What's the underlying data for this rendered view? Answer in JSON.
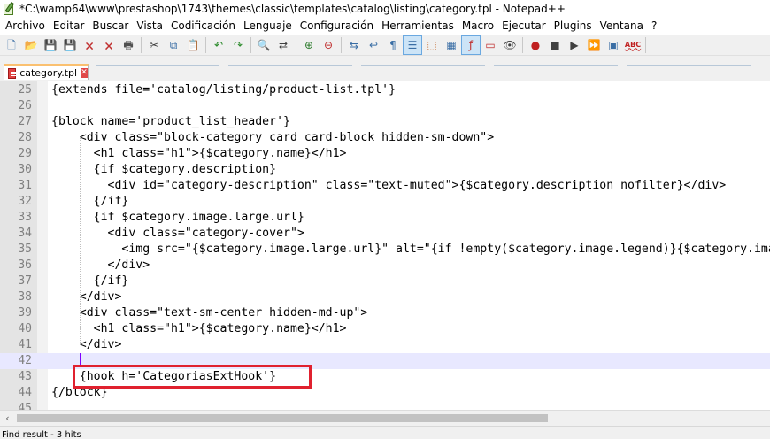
{
  "window": {
    "title": "*C:\\wamp64\\www\\prestashop\\1743\\themes\\classic\\templates\\catalog\\listing\\category.tpl - Notepad++"
  },
  "menu": {
    "items": [
      "Archivo",
      "Editar",
      "Buscar",
      "Vista",
      "Codificación",
      "Lenguaje",
      "Configuración",
      "Herramientas",
      "Macro",
      "Ejecutar",
      "Plugins",
      "Ventana",
      "?"
    ]
  },
  "toolbar": {
    "icons": [
      {
        "name": "new-file-icon",
        "glyph": "🗋",
        "color": "#3a6ea5"
      },
      {
        "name": "open-file-icon",
        "glyph": "📂",
        "color": "#c89b2b"
      },
      {
        "name": "save-icon",
        "glyph": "💾",
        "color": "#2e5fa8"
      },
      {
        "name": "save-all-icon",
        "glyph": "💾",
        "color": "#2e5fa8"
      },
      {
        "name": "close-icon",
        "glyph": "🗙",
        "color": "#c03030"
      },
      {
        "name": "close-all-icon",
        "glyph": "🗙",
        "color": "#c03030"
      },
      {
        "name": "print-icon",
        "glyph": "🖶",
        "color": "#505050"
      },
      {
        "name": "cut-icon",
        "glyph": "✂",
        "color": "#404040"
      },
      {
        "name": "copy-icon",
        "glyph": "⧉",
        "color": "#3a6ea5"
      },
      {
        "name": "paste-icon",
        "glyph": "📋",
        "color": "#a07a2a"
      },
      {
        "name": "undo-icon",
        "glyph": "↶",
        "color": "#2a8a2a"
      },
      {
        "name": "redo-icon",
        "glyph": "↷",
        "color": "#2a8a2a"
      },
      {
        "name": "find-icon",
        "glyph": "🔍",
        "color": "#404040"
      },
      {
        "name": "replace-icon",
        "glyph": "⇄",
        "color": "#404040"
      },
      {
        "name": "zoom-in-icon",
        "glyph": "⊕",
        "color": "#2a7a2a"
      },
      {
        "name": "zoom-out-icon",
        "glyph": "⊖",
        "color": "#c03030"
      },
      {
        "name": "sync-scroll-icon",
        "glyph": "⇆",
        "color": "#3a6ea5"
      },
      {
        "name": "word-wrap-icon",
        "glyph": "↩",
        "color": "#3a6ea5"
      },
      {
        "name": "show-all-chars-icon",
        "glyph": "¶",
        "color": "#3a6ea5"
      },
      {
        "name": "indent-guide-icon",
        "glyph": "☰",
        "color": "#3a6ea5"
      },
      {
        "name": "language-icon",
        "glyph": "⬚",
        "color": "#c06020"
      },
      {
        "name": "document-map-icon",
        "glyph": "▦",
        "color": "#3a6ea5"
      },
      {
        "name": "function-list-icon",
        "glyph": "ƒ",
        "color": "#c03030"
      },
      {
        "name": "folder-workspace-icon",
        "glyph": "▭",
        "color": "#c03030"
      },
      {
        "name": "monitoring-icon",
        "glyph": "👁",
        "color": "#404040"
      },
      {
        "name": "record-macro-icon",
        "glyph": "●",
        "color": "#c02020"
      },
      {
        "name": "stop-macro-icon",
        "glyph": "■",
        "color": "#404040"
      },
      {
        "name": "play-macro-icon",
        "glyph": "▶",
        "color": "#404040"
      },
      {
        "name": "run-macro-multiple-icon",
        "glyph": "⏩",
        "color": "#3a6ea5"
      },
      {
        "name": "save-macro-icon",
        "glyph": "▣",
        "color": "#3a6ea5"
      },
      {
        "name": "spell-check-icon",
        "glyph": "ABC",
        "color": "#c02020"
      }
    ]
  },
  "tabs": [
    {
      "label": "category.tpl",
      "close": "✕"
    }
  ],
  "editor": {
    "lines": [
      {
        "number": "25",
        "text": "{extends file='catalog/listing/product-list.tpl'}"
      },
      {
        "number": "26",
        "text": ""
      },
      {
        "number": "27",
        "text": "{block name='product_list_header'}"
      },
      {
        "number": "28",
        "text": "    <div class=\"block-category card card-block hidden-sm-down\">"
      },
      {
        "number": "29",
        "text": "      <h1 class=\"h1\">{$category.name}</h1>"
      },
      {
        "number": "30",
        "text": "      {if $category.description}"
      },
      {
        "number": "31",
        "text": "        <div id=\"category-description\" class=\"text-muted\">{$category.description nofilter}</div>"
      },
      {
        "number": "32",
        "text": "      {/if}"
      },
      {
        "number": "33",
        "text": "      {if $category.image.large.url}"
      },
      {
        "number": "34",
        "text": "        <div class=\"category-cover\">"
      },
      {
        "number": "35",
        "text": "          <img src=\"{$category.image.large.url}\" alt=\"{if !empty($category.image.legend)}{$category.image.legend}{else}{$category.name}{/if}\">"
      },
      {
        "number": "36",
        "text": "        </div>"
      },
      {
        "number": "37",
        "text": "      {/if}"
      },
      {
        "number": "38",
        "text": "    </div>"
      },
      {
        "number": "39",
        "text": "    <div class=\"text-sm-center hidden-md-up\">"
      },
      {
        "number": "40",
        "text": "      <h1 class=\"h1\">{$category.name}</h1>"
      },
      {
        "number": "41",
        "text": "    </div>"
      },
      {
        "number": "42",
        "text": ""
      },
      {
        "number": "43",
        "text": "    {hook h='CategoriasExtHook'}"
      },
      {
        "number": "44",
        "text": "{/block}"
      },
      {
        "number": "45",
        "text": ""
      }
    ],
    "current_line": "42"
  },
  "status": {
    "text": "Find result - 3 hits"
  },
  "colors": {
    "highlight_box": "#e0212f",
    "current_line": "#e8e8ff",
    "tab_accent": "#fac070"
  }
}
